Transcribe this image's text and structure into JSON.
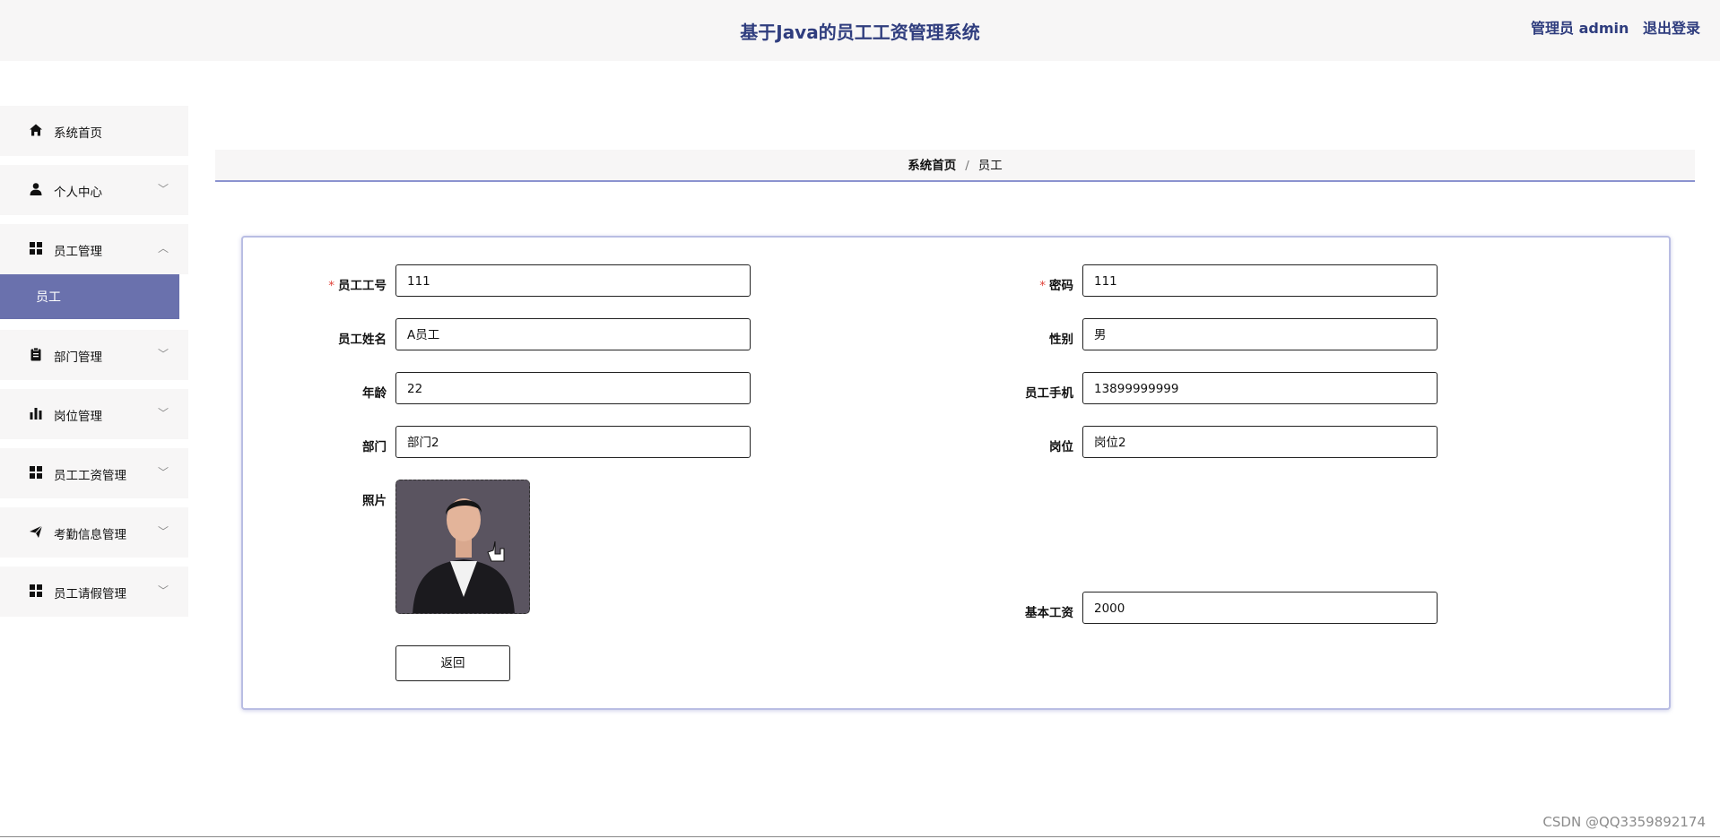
{
  "header": {
    "title": "基于Java的员工工资管理系统",
    "user_label": "管理员 admin",
    "logout_label": "退出登录"
  },
  "sidebar": {
    "items": [
      {
        "label": "系统首页",
        "icon": "home-icon"
      },
      {
        "label": "个人中心",
        "icon": "user-icon"
      },
      {
        "label": "员工管理",
        "icon": "grid-icon"
      },
      {
        "label": "部门管理",
        "icon": "clipboard-icon"
      },
      {
        "label": "岗位管理",
        "icon": "bar-chart-icon"
      },
      {
        "label": "员工工资管理",
        "icon": "grid-icon"
      },
      {
        "label": "考勤信息管理",
        "icon": "send-icon"
      },
      {
        "label": "员工请假管理",
        "icon": "grid-icon"
      }
    ],
    "active_sub": "员工",
    "accent_color": "#6a71ad"
  },
  "breadcrumb": {
    "home": "系统首页",
    "separator": "/",
    "current": "员工"
  },
  "form": {
    "employee_no": {
      "label": "员工工号",
      "value": "111",
      "required": true
    },
    "password": {
      "label": "密码",
      "value": "111",
      "required": true
    },
    "employee_name": {
      "label": "员工姓名",
      "value": "A员工"
    },
    "gender": {
      "label": "性别",
      "value": "男"
    },
    "age": {
      "label": "年龄",
      "value": "22"
    },
    "phone": {
      "label": "员工手机",
      "value": "13899999999"
    },
    "department": {
      "label": "部门",
      "value": "部门2"
    },
    "position": {
      "label": "岗位",
      "value": "岗位2"
    },
    "photo": {
      "label": "照片"
    },
    "base_salary": {
      "label": "基本工资",
      "value": "2000"
    },
    "return_label": "返回"
  },
  "watermark": "CSDN @QQ3359892174"
}
